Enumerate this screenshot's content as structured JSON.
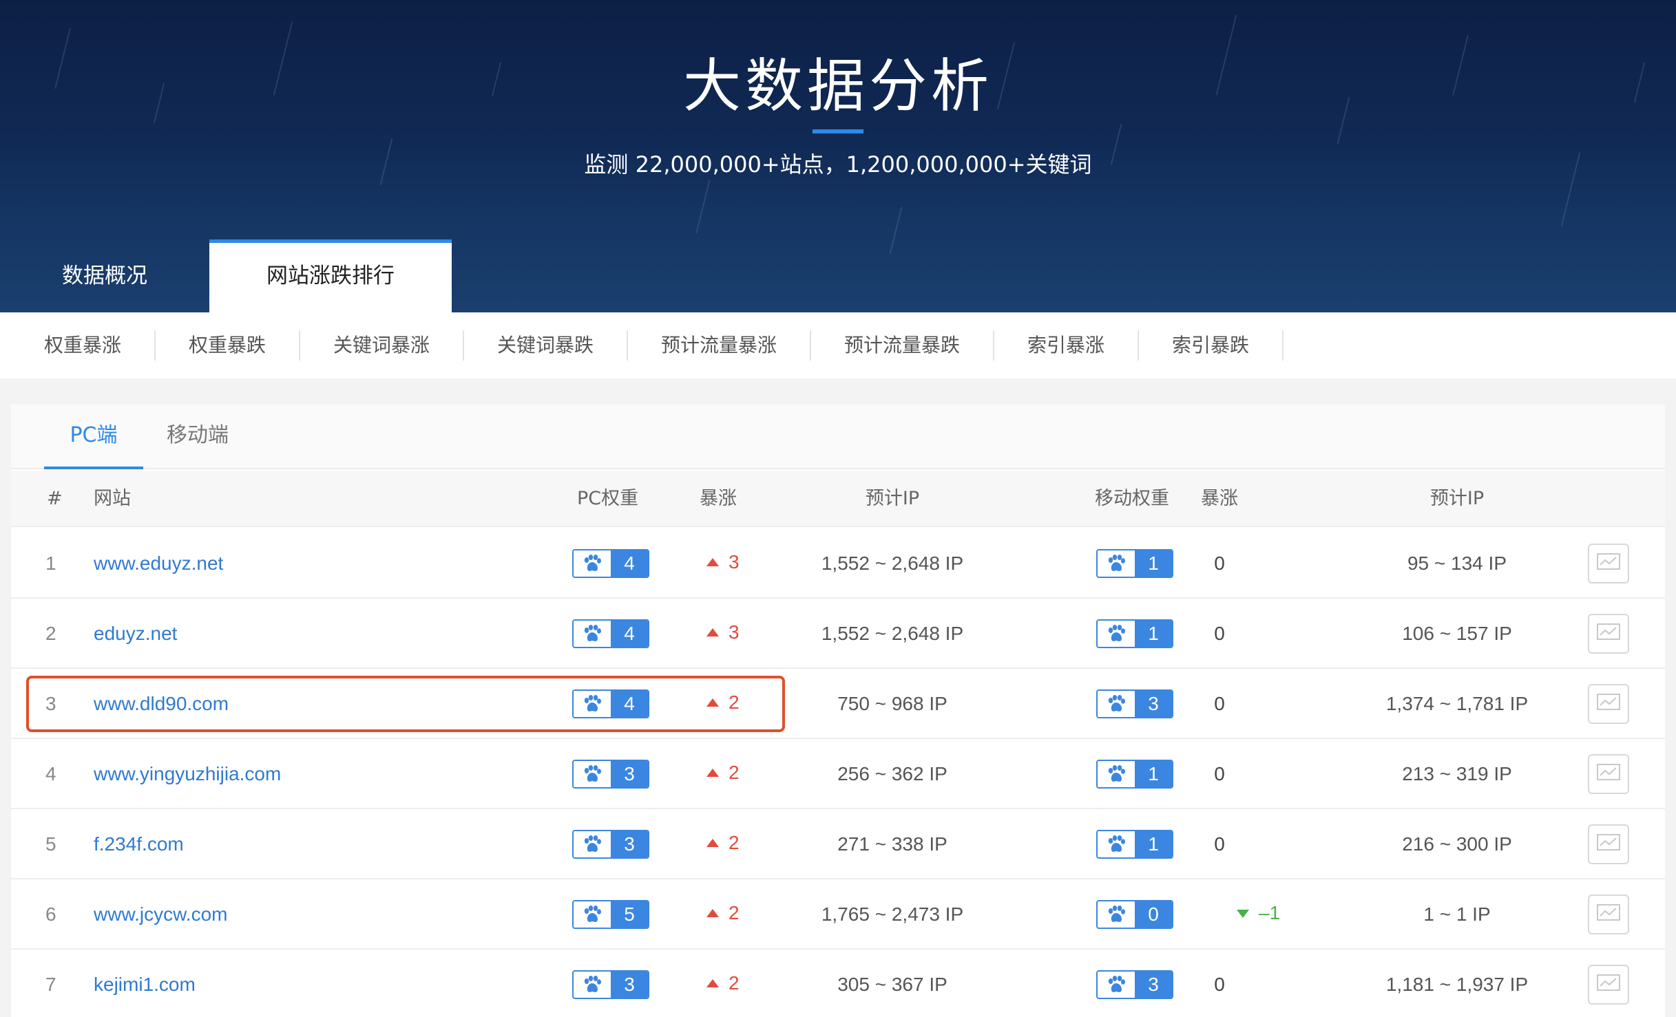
{
  "hero": {
    "title": "大数据分析",
    "subtitle": "监测 22,000,000+站点，1,200,000,000+关键词"
  },
  "main_tabs": [
    {
      "label": "数据概况",
      "active": false
    },
    {
      "label": "网站涨跌排行",
      "active": true
    }
  ],
  "categories": [
    "权重暴涨",
    "权重暴跌",
    "关键词暴涨",
    "关键词暴跌",
    "预计流量暴涨",
    "预计流量暴跌",
    "索引暴涨",
    "索引暴跌"
  ],
  "sub_tabs": [
    {
      "label": "PC端",
      "active": true
    },
    {
      "label": "移动端",
      "active": false
    }
  ],
  "table": {
    "headers": {
      "rank": "#",
      "site": "网站",
      "pc_weight": "PC权重",
      "pc_change": "暴涨",
      "pc_ip": "预计IP",
      "mobile_weight": "移动权重",
      "mobile_change": "暴涨",
      "mobile_ip": "预计IP"
    },
    "rows": [
      {
        "rank": "1",
        "site": "www.eduyz.net",
        "pc_weight": "4",
        "pc_change": "3",
        "pc_ip": "1,552 ~ 2,648 IP",
        "mobile_weight": "1",
        "mobile_change": "0",
        "mobile_ip": "95 ~ 134 IP"
      },
      {
        "rank": "2",
        "site": "eduyz.net",
        "pc_weight": "4",
        "pc_change": "3",
        "pc_ip": "1,552 ~ 2,648 IP",
        "mobile_weight": "1",
        "mobile_change": "0",
        "mobile_ip": "106 ~ 157 IP"
      },
      {
        "rank": "3",
        "site": "www.dld90.com",
        "pc_weight": "4",
        "pc_change": "2",
        "pc_ip": "750 ~ 968 IP",
        "mobile_weight": "3",
        "mobile_change": "0",
        "mobile_ip": "1,374 ~ 1,781 IP"
      },
      {
        "rank": "4",
        "site": "www.yingyuzhijia.com",
        "pc_weight": "3",
        "pc_change": "2",
        "pc_ip": "256 ~ 362 IP",
        "mobile_weight": "1",
        "mobile_change": "0",
        "mobile_ip": "213 ~ 319 IP"
      },
      {
        "rank": "5",
        "site": "f.234f.com",
        "pc_weight": "3",
        "pc_change": "2",
        "pc_ip": "271 ~ 338 IP",
        "mobile_weight": "1",
        "mobile_change": "0",
        "mobile_ip": "216 ~ 300 IP"
      },
      {
        "rank": "6",
        "site": "www.jcycw.com",
        "pc_weight": "5",
        "pc_change": "2",
        "pc_ip": "1,765 ~ 2,473 IP",
        "mobile_weight": "0",
        "mobile_change": "-1",
        "mobile_ip": "1 ~ 1 IP"
      },
      {
        "rank": "7",
        "site": "kejimi1.com",
        "pc_weight": "3",
        "pc_change": "2",
        "pc_ip": "305 ~ 367 IP",
        "mobile_weight": "3",
        "mobile_change": "0",
        "mobile_ip": "1,181 ~ 1,937 IP"
      }
    ]
  },
  "colors": {
    "accent": "#2e8ae6",
    "link": "#2f7ad0",
    "badge": "#3b86e0",
    "up": "#e24b3b",
    "down": "#47b04b",
    "highlight": "#e0502a"
  },
  "icons": {
    "weight_badge": "baidu-paw-icon",
    "row_action": "trend-chart-icon"
  }
}
